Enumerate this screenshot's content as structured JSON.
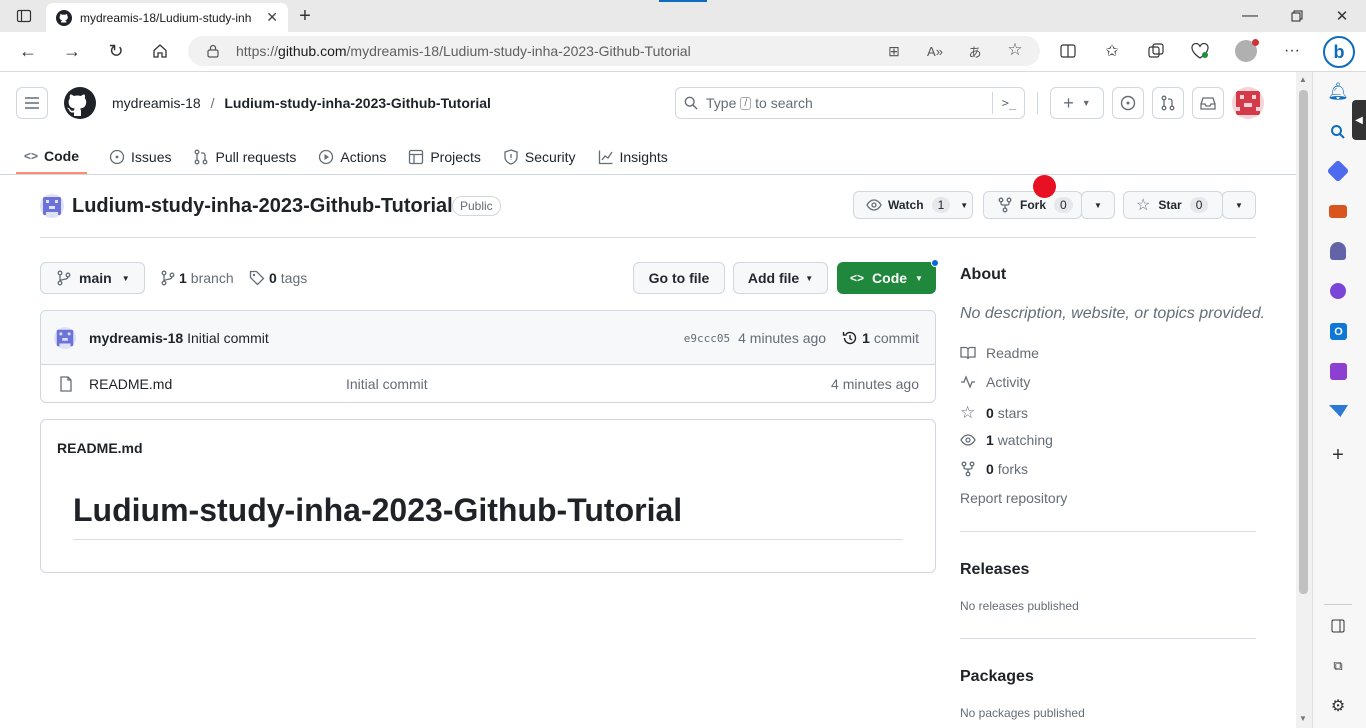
{
  "browser": {
    "tab_title": "mydreamis-18/Ludium-study-inh",
    "url_prefix": "https://",
    "url_host": "github.com",
    "url_path": "/mydreamis-18/Ludium-study-inha-2023-Github-Tutorial"
  },
  "header": {
    "owner": "mydreamis-18",
    "separator": "/",
    "repo": "Ludium-study-inha-2023-Github-Tutorial",
    "search_prefix": "Type",
    "search_key": "/",
    "search_suffix": "to search"
  },
  "tabs": [
    {
      "label": "Code",
      "icon": "code-icon"
    },
    {
      "label": "Issues",
      "icon": "issue-icon"
    },
    {
      "label": "Pull requests",
      "icon": "pull-request-icon"
    },
    {
      "label": "Actions",
      "icon": "play-icon"
    },
    {
      "label": "Projects",
      "icon": "table-icon"
    },
    {
      "label": "Security",
      "icon": "shield-icon"
    },
    {
      "label": "Insights",
      "icon": "graph-icon"
    }
  ],
  "repo": {
    "title": "Ludium-study-inha-2023-Github-Tutorial",
    "visibility": "Public",
    "watch_label": "Watch",
    "watch_count": "1",
    "fork_label": "Fork",
    "fork_count": "0",
    "star_label": "Star",
    "star_count": "0"
  },
  "toolbar": {
    "branch": "main",
    "branch_count": "1",
    "branch_word": "branch",
    "tag_count": "0",
    "tag_word": "tags",
    "go_to_file": "Go to file",
    "add_file": "Add file",
    "code": "Code"
  },
  "commit": {
    "author": "mydreamis-18",
    "message": "Initial commit",
    "hash": "e9ccc05",
    "time": "4 minutes ago",
    "commit_count": "1",
    "commit_word": "commit"
  },
  "files": [
    {
      "name": "README.md",
      "message": "Initial commit",
      "time": "4 minutes ago"
    }
  ],
  "readme": {
    "filename": "README.md",
    "heading": "Ludium-study-inha-2023-Github-Tutorial"
  },
  "about": {
    "title": "About",
    "description": "No description, website, or topics provided.",
    "readme": "Readme",
    "activity": "Activity",
    "stars_count": "0",
    "stars_word": "stars",
    "watching_count": "1",
    "watching_word": "watching",
    "forks_count": "0",
    "forks_word": "forks",
    "report": "Report repository"
  },
  "releases": {
    "title": "Releases",
    "empty": "No releases published"
  },
  "packages": {
    "title": "Packages",
    "empty": "No packages published"
  },
  "colors": {
    "accent": "#fd8c73",
    "code_green": "#1f883d",
    "marker_red": "#e81123"
  }
}
